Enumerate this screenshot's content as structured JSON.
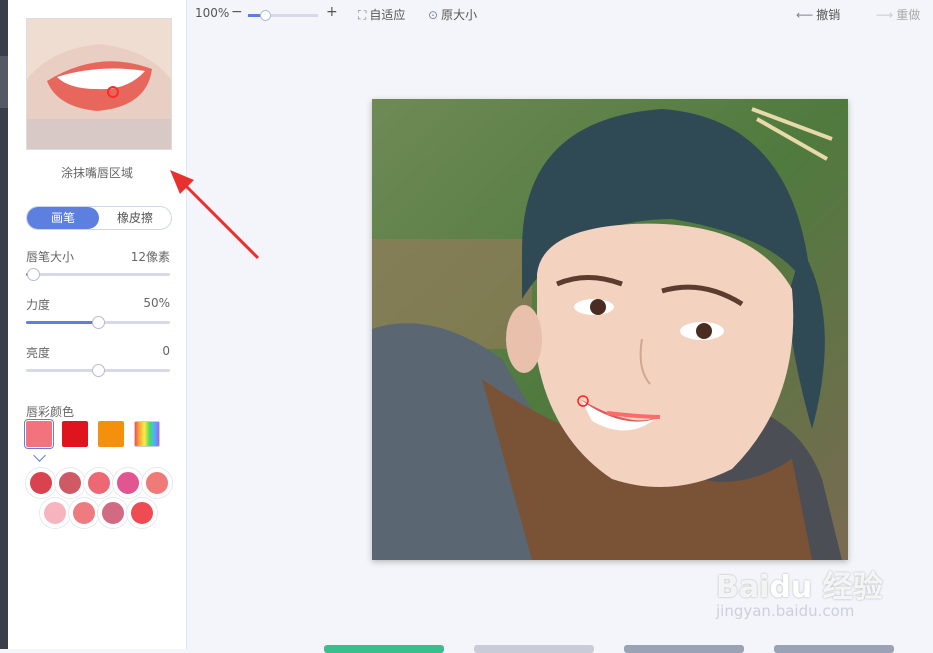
{
  "toolbar": {
    "zoom_value": "100%",
    "zoom_level": 0.25,
    "minus": "−",
    "plus": "+",
    "fit_label": "自适应",
    "original_label": "原大小",
    "undo_label": "撤销",
    "redo_label": "重做"
  },
  "panel": {
    "caption": "涂抹嘴唇区域",
    "tools": [
      "画笔",
      "橡皮擦"
    ],
    "active_tool": "画笔",
    "sliders": [
      {
        "label": "唇笔大小",
        "value_text": "12像素",
        "level": 0.05
      },
      {
        "label": "力度",
        "value_text": "50%",
        "level": 0.5
      },
      {
        "label": "亮度",
        "value_text": "0",
        "level": 0.5
      }
    ],
    "color_label": "唇彩颜色",
    "main_colors": [
      "#f2727e",
      "#e0141e",
      "#f5900d",
      "rainbow"
    ],
    "palette_colors": [
      "#d8434f",
      "#cf5a66",
      "#ee6874",
      "#e25591",
      "#f07a78",
      "#f7b4bf",
      "#ee7b80",
      "#d26a83",
      "#ef4b52"
    ]
  },
  "watermark": {
    "brand": "Bai du 经验",
    "url": "jingyan.baidu.com"
  }
}
